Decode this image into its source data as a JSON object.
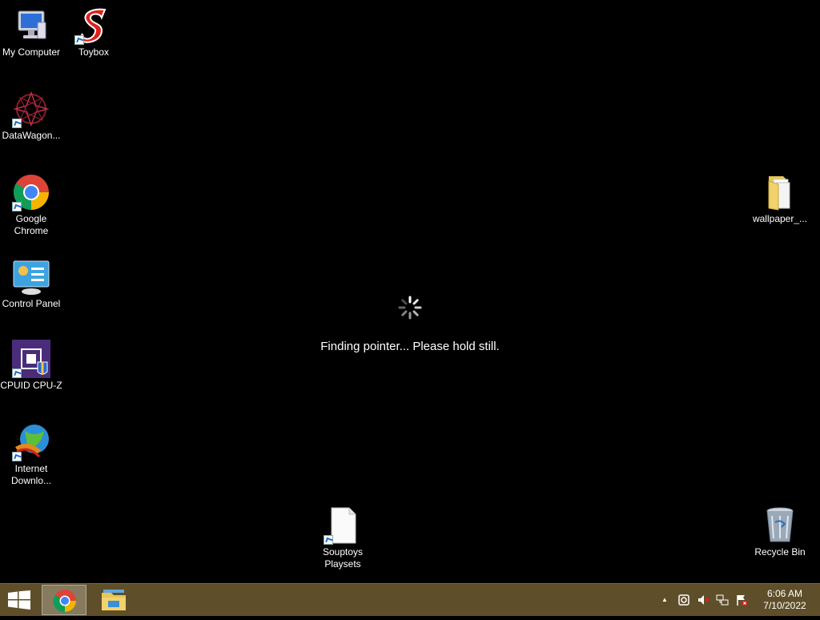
{
  "desktop_icons": {
    "my_computer": "My Computer",
    "toybox": "Toybox",
    "datawagon": "DataWagon...",
    "chrome_line1": "Google",
    "chrome_line2": "Chrome",
    "control_panel": "Control Panel",
    "cpuz": "CPUID CPU-Z",
    "idm_line1": "Internet",
    "idm_line2": "Downlo...",
    "wallpaper": "wallpaper_...",
    "souptoys_line1": "Souptoys",
    "souptoys_line2": "Playsets",
    "recycle_bin": "Recycle Bin"
  },
  "overlay": {
    "status_text": "Finding pointer... Please hold still."
  },
  "taskbar": {
    "time": "6:06 AM",
    "date": "7/10/2022",
    "tray_up_arrow": "▲"
  },
  "colors": {
    "desktop_bg": "#000000",
    "taskbar_bg": "#5e4f2a"
  }
}
